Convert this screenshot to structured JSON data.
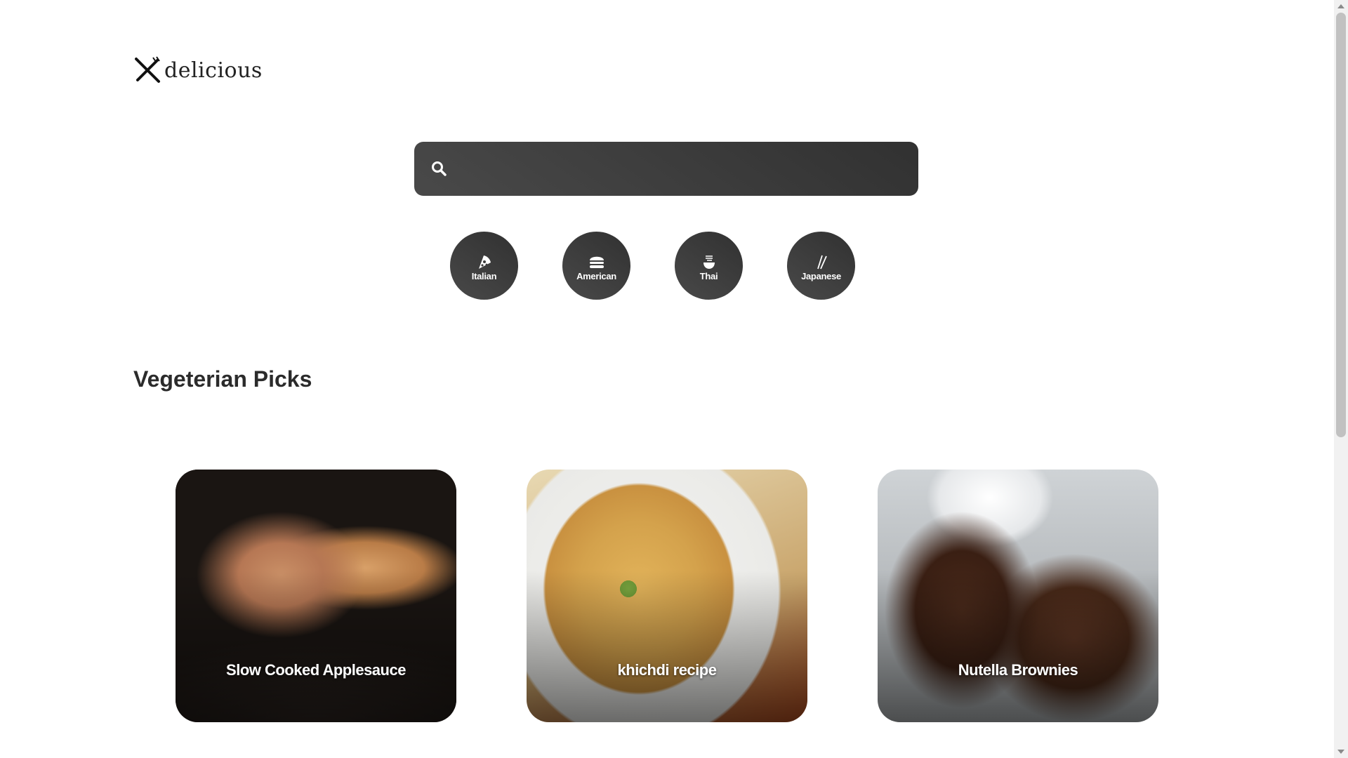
{
  "logo": {
    "text": "delicious",
    "icon": "fork-knife-icon"
  },
  "search": {
    "value": "",
    "placeholder": "",
    "icon": "search-icon"
  },
  "categories": [
    {
      "label": "Italian",
      "icon": "pizza-icon"
    },
    {
      "label": "American",
      "icon": "hamburger-icon"
    },
    {
      "label": "Thai",
      "icon": "noodle-bowl-icon"
    },
    {
      "label": "Japanese",
      "icon": "chopsticks-icon"
    }
  ],
  "section": {
    "title": "Vegeterian Picks"
  },
  "cards": [
    {
      "title": "Slow Cooked Applesauce"
    },
    {
      "title": "khichdi recipe"
    },
    {
      "title": "Nutella Brownies"
    }
  ],
  "colors": {
    "dark_gradient_start": "#494949",
    "dark_gradient_end": "#313131",
    "text_primary": "#2b2b2b"
  }
}
